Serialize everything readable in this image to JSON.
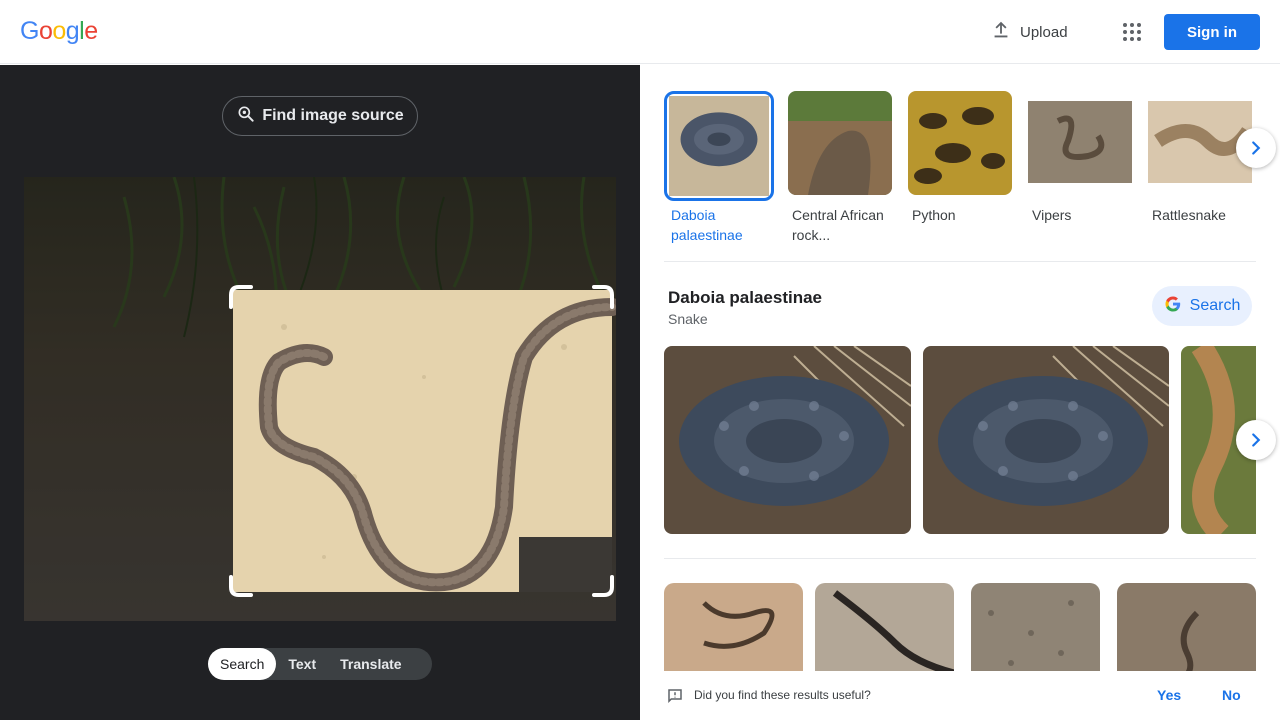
{
  "header": {
    "logo_letters": [
      {
        "ch": "G",
        "color": "#4285f4"
      },
      {
        "ch": "o",
        "color": "#ea4335"
      },
      {
        "ch": "o",
        "color": "#fbbc05"
      },
      {
        "ch": "g",
        "color": "#4285f4"
      },
      {
        "ch": "l",
        "color": "#34a853"
      },
      {
        "ch": "e",
        "color": "#ea4335"
      }
    ],
    "upload_label": "Upload",
    "apps_icon": "apps-grid-icon",
    "signin_label": "Sign in"
  },
  "left": {
    "find_source_label": "Find image source",
    "modes": [
      "Search",
      "Text",
      "Translate"
    ],
    "active_mode": "Search"
  },
  "results": {
    "chips": [
      {
        "label": "Daboia palaestinae",
        "selected": true
      },
      {
        "label": "Central African rock...",
        "selected": false
      },
      {
        "label": "Python",
        "selected": false
      },
      {
        "label": "Vipers",
        "selected": false
      },
      {
        "label": "Rattlesnake",
        "selected": false
      }
    ],
    "entity": {
      "title": "Daboia palaestinae",
      "subtitle": "Snake",
      "search_label": "Search"
    },
    "feedback": {
      "question": "Did you find these results useful?",
      "yes": "Yes",
      "no": "No"
    }
  },
  "colors": {
    "accent": "#1a73e8",
    "dark_panel": "#202124"
  }
}
